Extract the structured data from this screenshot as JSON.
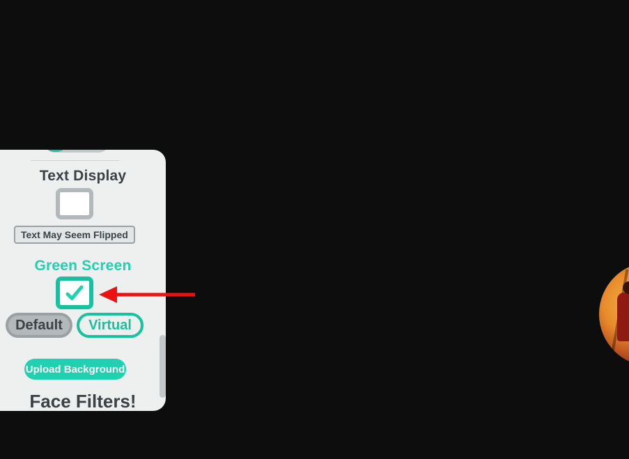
{
  "colors": {
    "accent": "#18c1a0",
    "accent_bright": "#1fd1b0",
    "muted": "#b3b8ba",
    "text": "#3b4144",
    "panel_bg": "#eeefef"
  },
  "panel": {
    "sections": {
      "text_display": {
        "title": "Text Display",
        "checked": false,
        "note": "Text May Seem Flipped"
      },
      "green_screen": {
        "title": "Green Screen",
        "checked": true,
        "modes": {
          "default_label": "Default",
          "virtual_label": "Virtual",
          "selected": "Virtual"
        },
        "upload_label": "Upload Background"
      },
      "face_filters": {
        "title": "Face Filters!"
      }
    }
  },
  "annotation": {
    "arrow_target": "green-screen-checkbox"
  }
}
